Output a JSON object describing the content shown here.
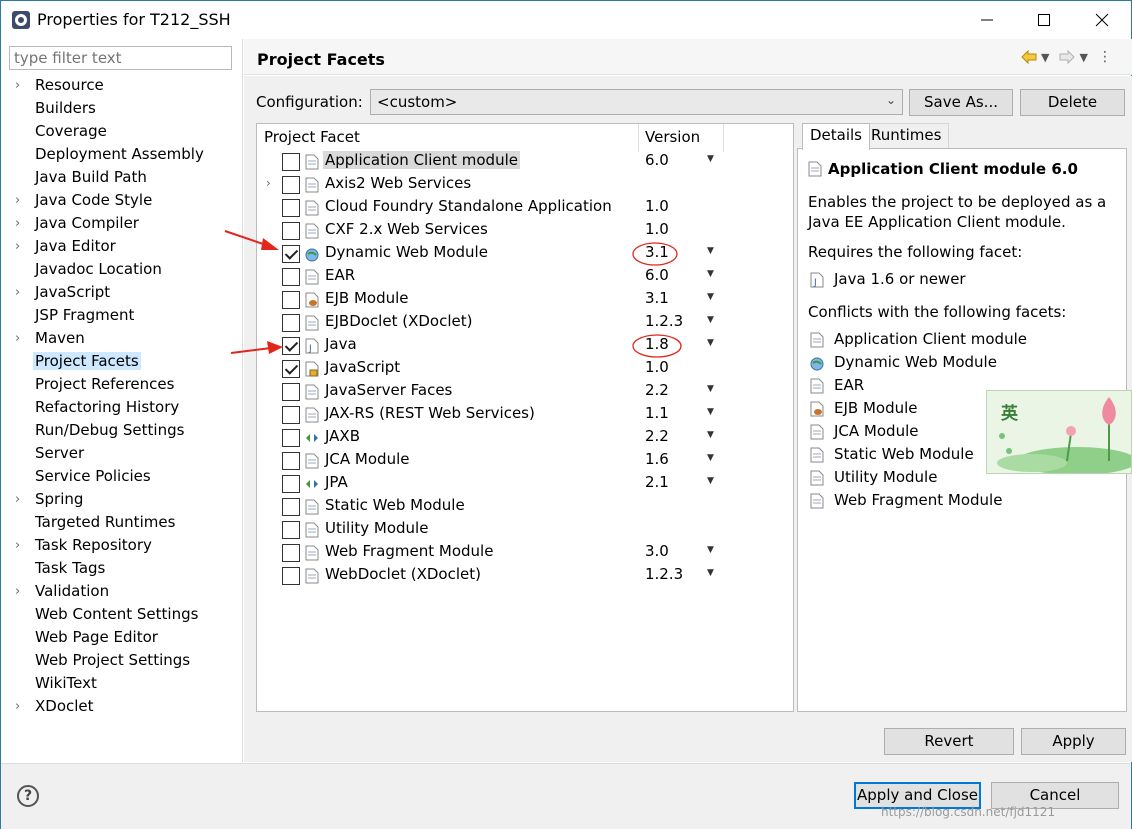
{
  "window": {
    "title": "Properties for T212_SSH"
  },
  "filter": {
    "placeholder": "type filter text"
  },
  "tree": [
    {
      "label": "Resource",
      "expandable": true
    },
    {
      "label": "Builders",
      "expandable": false
    },
    {
      "label": "Coverage",
      "expandable": false
    },
    {
      "label": "Deployment Assembly",
      "expandable": false
    },
    {
      "label": "Java Build Path",
      "expandable": false
    },
    {
      "label": "Java Code Style",
      "expandable": true
    },
    {
      "label": "Java Compiler",
      "expandable": true
    },
    {
      "label": "Java Editor",
      "expandable": true
    },
    {
      "label": "Javadoc Location",
      "expandable": false
    },
    {
      "label": "JavaScript",
      "expandable": true
    },
    {
      "label": "JSP Fragment",
      "expandable": false
    },
    {
      "label": "Maven",
      "expandable": true
    },
    {
      "label": "Project Facets",
      "expandable": false,
      "selected": true
    },
    {
      "label": "Project References",
      "expandable": false
    },
    {
      "label": "Refactoring History",
      "expandable": false
    },
    {
      "label": "Run/Debug Settings",
      "expandable": false
    },
    {
      "label": "Server",
      "expandable": false
    },
    {
      "label": "Service Policies",
      "expandable": false
    },
    {
      "label": "Spring",
      "expandable": true
    },
    {
      "label": "Targeted Runtimes",
      "expandable": false
    },
    {
      "label": "Task Repository",
      "expandable": true
    },
    {
      "label": "Task Tags",
      "expandable": false
    },
    {
      "label": "Validation",
      "expandable": true
    },
    {
      "label": "Web Content Settings",
      "expandable": false
    },
    {
      "label": "Web Page Editor",
      "expandable": false
    },
    {
      "label": "Web Project Settings",
      "expandable": false
    },
    {
      "label": "WikiText",
      "expandable": false
    },
    {
      "label": "XDoclet",
      "expandable": true
    }
  ],
  "page": {
    "title": "Project Facets"
  },
  "configuration": {
    "label": "Configuration:",
    "value": "<custom>",
    "save_as": "Save As...",
    "delete": "Delete"
  },
  "facets_table": {
    "col_facet": "Project Facet",
    "col_version": "Version",
    "rows": [
      {
        "name": "Application Client module",
        "version": "6.0",
        "checked": false,
        "dropdown": true,
        "icon": "page-icon",
        "highlighted": true
      },
      {
        "name": "Axis2 Web Services",
        "version": "",
        "checked": false,
        "dropdown": false,
        "icon": "page-icon",
        "expandable": true
      },
      {
        "name": "Cloud Foundry Standalone Application",
        "version": "1.0",
        "checked": false,
        "dropdown": false,
        "icon": "page-icon"
      },
      {
        "name": "CXF 2.x Web Services",
        "version": "1.0",
        "checked": false,
        "dropdown": false,
        "icon": "page-icon"
      },
      {
        "name": "Dynamic Web Module",
        "version": "3.1",
        "checked": true,
        "dropdown": true,
        "icon": "globe-icon",
        "circled": true
      },
      {
        "name": "EAR",
        "version": "6.0",
        "checked": false,
        "dropdown": true,
        "icon": "page-icon"
      },
      {
        "name": "EJB Module",
        "version": "3.1",
        "checked": false,
        "dropdown": true,
        "icon": "bean-icon"
      },
      {
        "name": "EJBDoclet (XDoclet)",
        "version": "1.2.3",
        "checked": false,
        "dropdown": true,
        "icon": "page-icon"
      },
      {
        "name": "Java",
        "version": "1.8",
        "checked": true,
        "dropdown": true,
        "icon": "java-file-icon",
        "circled": true
      },
      {
        "name": "JavaScript",
        "version": "1.0",
        "checked": true,
        "dropdown": false,
        "icon": "js-lock-icon"
      },
      {
        "name": "JavaServer Faces",
        "version": "2.2",
        "checked": false,
        "dropdown": true,
        "icon": "page-icon"
      },
      {
        "name": "JAX-RS (REST Web Services)",
        "version": "1.1",
        "checked": false,
        "dropdown": true,
        "icon": "page-icon"
      },
      {
        "name": "JAXB",
        "version": "2.2",
        "checked": false,
        "dropdown": true,
        "icon": "arrows-icon"
      },
      {
        "name": "JCA Module",
        "version": "1.6",
        "checked": false,
        "dropdown": true,
        "icon": "page-icon"
      },
      {
        "name": "JPA",
        "version": "2.1",
        "checked": false,
        "dropdown": true,
        "icon": "arrows-icon"
      },
      {
        "name": "Static Web Module",
        "version": "",
        "checked": false,
        "dropdown": false,
        "icon": "page-icon"
      },
      {
        "name": "Utility Module",
        "version": "",
        "checked": false,
        "dropdown": false,
        "icon": "page-icon"
      },
      {
        "name": "Web Fragment Module",
        "version": "3.0",
        "checked": false,
        "dropdown": true,
        "icon": "page-icon"
      },
      {
        "name": "WebDoclet (XDoclet)",
        "version": "1.2.3",
        "checked": false,
        "dropdown": true,
        "icon": "page-icon"
      }
    ]
  },
  "details": {
    "tab_details": "Details",
    "tab_runtimes": "Runtimes",
    "title": "Application Client module 6.0",
    "description": "Enables the project to be deployed as a Java EE Application Client module.",
    "requires_label": "Requires the following facet:",
    "requires": [
      {
        "name": "Java 1.6 or newer",
        "icon": "java-file-icon"
      }
    ],
    "conflicts_label": "Conflicts with the following facets:",
    "conflicts": [
      {
        "name": "Application Client module",
        "icon": "page-icon"
      },
      {
        "name": "Dynamic Web Module",
        "icon": "globe-icon"
      },
      {
        "name": "EAR",
        "icon": "page-icon"
      },
      {
        "name": "EJB Module",
        "icon": "bean-icon"
      },
      {
        "name": "JCA Module",
        "icon": "page-icon"
      },
      {
        "name": "Static Web Module",
        "icon": "page-icon"
      },
      {
        "name": "Utility Module",
        "icon": "page-icon"
      },
      {
        "name": "Web Fragment Module",
        "icon": "page-icon"
      }
    ]
  },
  "buttons": {
    "revert": "Revert",
    "apply": "Apply",
    "apply_and_close": "Apply and Close",
    "cancel": "Cancel"
  },
  "sticker_text": "英",
  "watermark": "https://blog.csdn.net/fjd1121",
  "colors": {
    "accent": "#0078d7",
    "selection": "#cde8ff",
    "annotation": "#e2261c"
  }
}
